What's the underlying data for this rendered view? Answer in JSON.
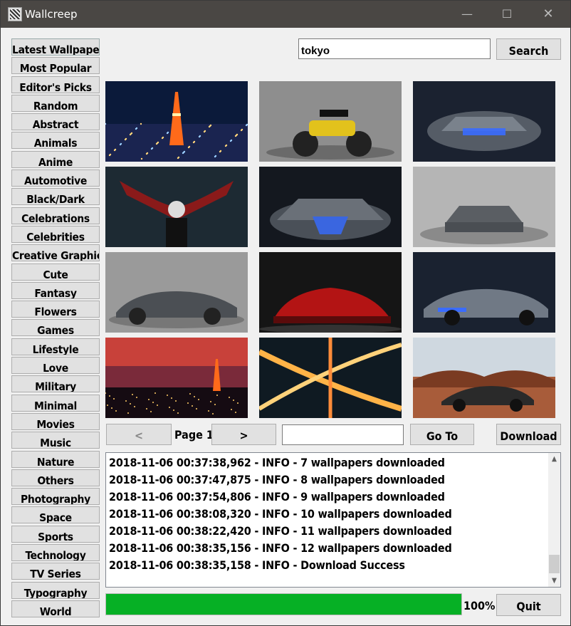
{
  "window": {
    "title": "Wallcreep",
    "minimize": "—",
    "maximize": "☐",
    "close": "✕"
  },
  "categories": [
    "Latest Wallpapers",
    "Most Popular",
    "Editor's Picks",
    "Random",
    "Abstract",
    "Animals",
    "Anime",
    "Automotive",
    "Black/Dark",
    "Celebrations",
    "Celebrities",
    "Creative Graphics",
    "Cute",
    "Fantasy",
    "Flowers",
    "Games",
    "Lifestyle",
    "Love",
    "Military",
    "Minimal",
    "Movies",
    "Music",
    "Nature",
    "Others",
    "Photography",
    "Space",
    "Sports",
    "Technology",
    "TV Series",
    "Typography",
    "World"
  ],
  "search": {
    "value": "tokyo",
    "button": "Search"
  },
  "thumbnails": [
    {
      "name": "tokyo-tower-night-thumbnail",
      "scene": "city-night"
    },
    {
      "name": "motorcycle-thumbnail",
      "scene": "motorcycle"
    },
    {
      "name": "lexus-concept-thumbnail",
      "scene": "car-blue"
    },
    {
      "name": "anime-character-thumbnail",
      "scene": "anime"
    },
    {
      "name": "lexus-front-thumbnail",
      "scene": "car-front"
    },
    {
      "name": "mazda-front-thumbnail",
      "scene": "car-grey"
    },
    {
      "name": "mazda-vision-thumbnail",
      "scene": "car-side"
    },
    {
      "name": "red-mazda-thumbnail",
      "scene": "car-red"
    },
    {
      "name": "lexus-silver-thumbnail",
      "scene": "car-blue2"
    },
    {
      "name": "tokyo-sunset-thumbnail",
      "scene": "sunset"
    },
    {
      "name": "highway-interchange-thumbnail",
      "scene": "highway"
    },
    {
      "name": "acura-nsx-thumbnail",
      "scene": "desert-car"
    }
  ],
  "pager": {
    "prev": "<",
    "page_label": "Page 1",
    "next": ">",
    "goto_value": "",
    "goto": "Go To",
    "download": "Download"
  },
  "log": [
    "2018-11-06 00:37:38,962 - INFO - 7 wallpapers downloaded",
    "2018-11-06 00:37:47,875 - INFO - 8 wallpapers downloaded",
    "2018-11-06 00:37:54,806 - INFO - 9 wallpapers downloaded",
    "2018-11-06 00:38:08,320 - INFO - 10 wallpapers downloaded",
    "2018-11-06 00:38:22,420 - INFO - 11 wallpapers downloaded",
    "2018-11-06 00:38:35,156 - INFO - 12 wallpapers downloaded",
    "2018-11-06 00:38:35,158 - INFO - Download Success"
  ],
  "progress": {
    "value": 1.0,
    "text": "100%",
    "color": "#06b025"
  },
  "quit": "Quit",
  "scroll": {
    "up": "▲",
    "down": "▼"
  }
}
